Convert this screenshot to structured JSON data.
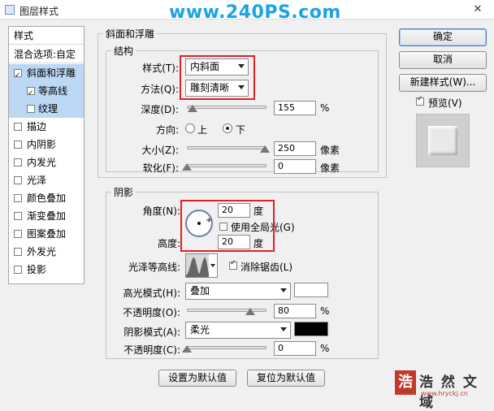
{
  "window": {
    "title": "图层样式",
    "watermark": "www.240PS.com",
    "close": "✕"
  },
  "left_list": {
    "header": "样式",
    "blend_options": "混合选项:自定",
    "items": [
      {
        "label": "斜面和浮雕",
        "checked": true,
        "selected": true
      },
      {
        "label": "等高线",
        "checked": true,
        "selected": true,
        "sub": true
      },
      {
        "label": "纹理",
        "checked": false,
        "selected": true,
        "sub": true
      },
      {
        "label": "描边",
        "checked": false
      },
      {
        "label": "内阴影",
        "checked": false
      },
      {
        "label": "内发光",
        "checked": false
      },
      {
        "label": "光泽",
        "checked": false
      },
      {
        "label": "颜色叠加",
        "checked": false
      },
      {
        "label": "渐变叠加",
        "checked": false
      },
      {
        "label": "图案叠加",
        "checked": false
      },
      {
        "label": "外发光",
        "checked": false
      },
      {
        "label": "投影",
        "checked": false
      }
    ]
  },
  "bevel": {
    "group_title": "斜面和浮雕",
    "structure_title": "结构",
    "style_label": "样式(T):",
    "style_value": "内斜面",
    "technique_label": "方法(Q):",
    "technique_value": "雕刻清晰",
    "depth_label": "深度(D):",
    "depth_value": "155",
    "depth_unit": "%",
    "depth_pos": 0.07,
    "direction_label": "方向:",
    "dir_up": "上",
    "dir_down": "下",
    "direction_selected": "下",
    "size_label": "大小(Z):",
    "size_value": "250",
    "size_unit": "像素",
    "size_pos": 0.98,
    "soften_label": "软化(F):",
    "soften_value": "0",
    "soften_unit": "像素",
    "soften_pos": 0.0
  },
  "shading": {
    "title": "阴影",
    "angle_label": "角度(N):",
    "angle_value": "20",
    "angle_unit": "度",
    "global_light_label": "使用全局光(G)",
    "global_light_checked": false,
    "altitude_label": "高度:",
    "altitude_value": "20",
    "altitude_unit": "度",
    "gloss_label": "光泽等高线:",
    "antialias_label": "消除锯齿(L)",
    "antialias_checked": true,
    "highlight_mode_label": "高光模式(H):",
    "highlight_mode_value": "叠加",
    "highlight_color": "#ffffff",
    "hl_opacity_label": "不透明度(O):",
    "hl_opacity_value": "80",
    "hl_opacity_unit": "%",
    "hl_opacity_pos": 0.8,
    "shadow_mode_label": "阴影模式(A):",
    "shadow_mode_value": "柔光",
    "shadow_color": "#000000",
    "sh_opacity_label": "不透明度(C):",
    "sh_opacity_value": "0",
    "sh_opacity_unit": "%",
    "sh_opacity_pos": 0.0
  },
  "bottom_buttons": {
    "make_default": "设置为默认值",
    "reset_default": "复位为默认值"
  },
  "right_buttons": {
    "ok": "确定",
    "cancel": "取消",
    "new_style": "新建样式(W)...",
    "preview_label": "预览(V)",
    "preview_checked": true
  },
  "footer": {
    "logo_text": "浩 然 文 域",
    "site": "www.hryckj.cn"
  }
}
